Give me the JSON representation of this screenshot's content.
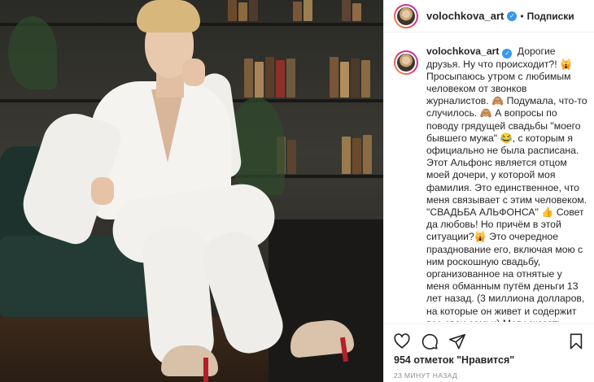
{
  "post": {
    "author": "volochkova_art",
    "follow_label": "Подписки",
    "separator": "•",
    "verified_glyph": "✓"
  },
  "caption": {
    "author": "volochkova_art",
    "text": "Дорогие друзья. Ну что происходит?! 🙀 Просыпаюсь утром с любимым человеком от звонков журналистов. 🙈 Подумала, что-то случилось. 🙈 А вопросы по поводу грядущей свадьбы \"моего бывшего мужа\" 😂, с которым я официально не была расписана. Этот Альфонс является отцом моей дочери, у которой моя фамилия. Это единственное, что меня связывает с этим человеком. \"СВАДЬБА АЛЬФОНСА\" 👍 Совет да любовь! Но причём в этой ситуации?🙀 Это очередное празднование его, включая мою с ним роскошную свадьбу, организованное на отнятые у меня обманным путём деньги 13 лет назад. (3 миллиона долларов, на которые он живет и содержит все свои семьи) Могу сказать правду, как есть. С первых дней нашего знакомства мой \"бывший муж\""
  },
  "stats": {
    "likes": "954 отметок \"Нравится\"",
    "time_ago": "23 МИНУТ НАЗАД"
  },
  "icons": {
    "like": "heart-icon",
    "comment": "comment-icon",
    "share": "share-icon",
    "save": "bookmark-icon"
  },
  "colors": {
    "verified": "#3897f0",
    "text": "#262626",
    "muted": "#8e8e8e",
    "suit": "#f4f3f0",
    "sofa": "#233a35"
  }
}
